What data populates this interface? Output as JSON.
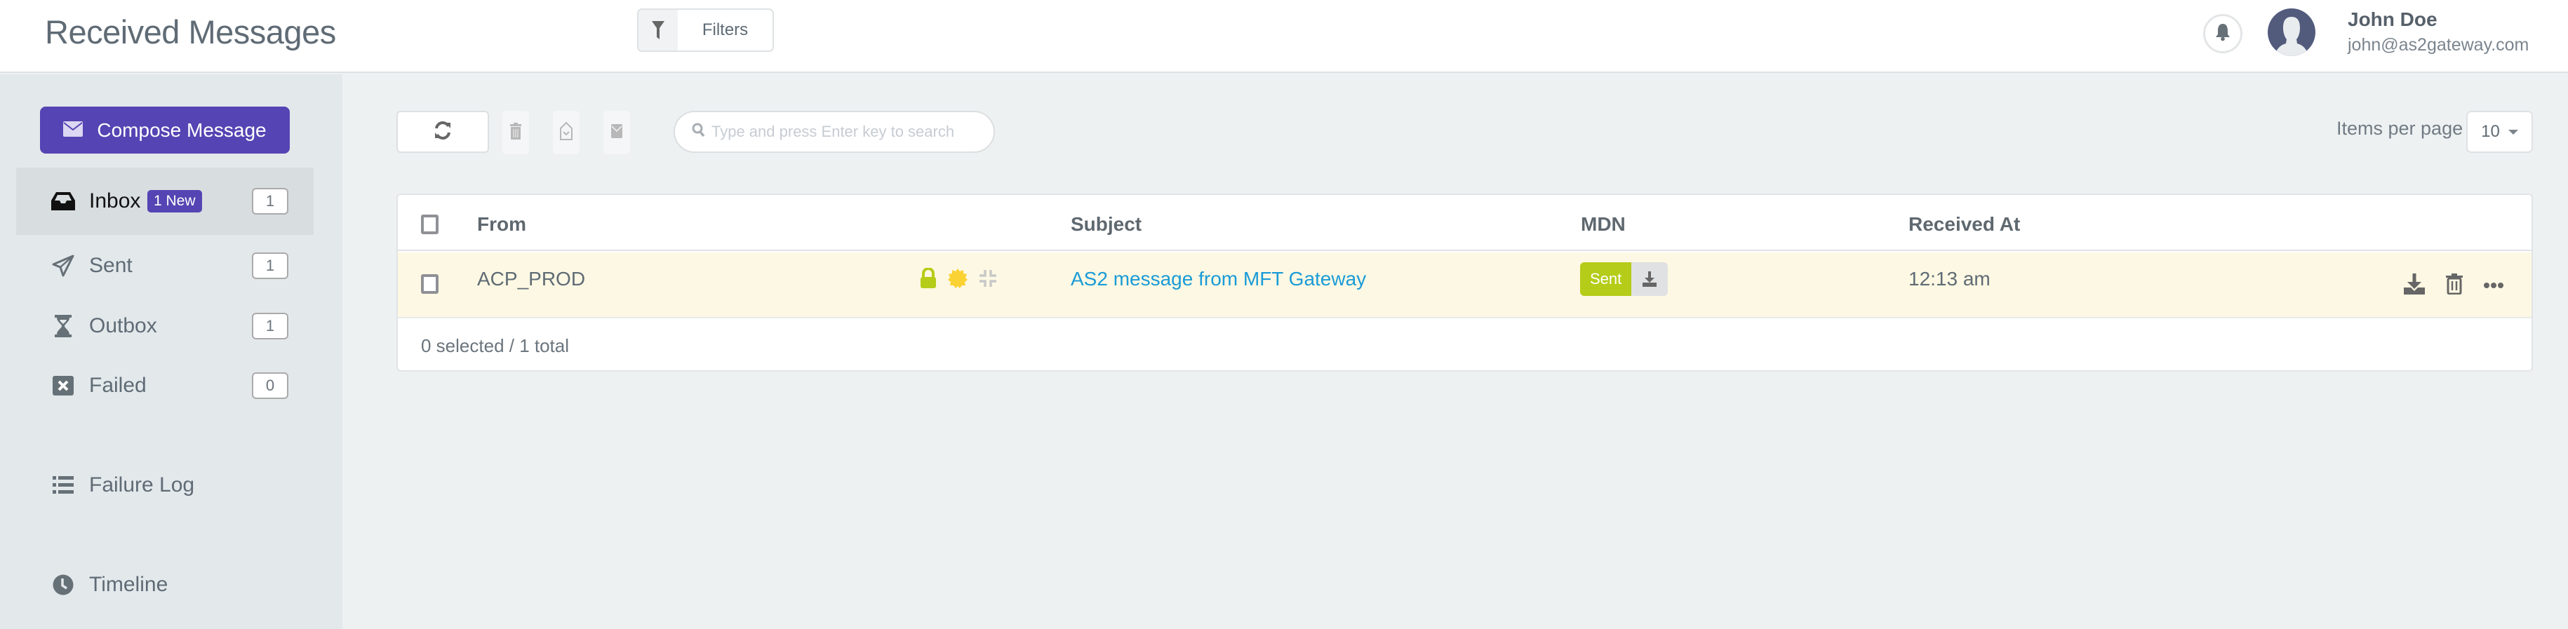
{
  "header": {
    "title": "Received Messages",
    "filters_label": "Filters",
    "user": {
      "name": "John Doe",
      "email": "john@as2gateway.com"
    }
  },
  "sidebar": {
    "compose_label": "Compose Message",
    "items": [
      {
        "label": "Inbox",
        "icon": "inbox-icon",
        "badge": "1 New",
        "count": "1",
        "active": true
      },
      {
        "label": "Sent",
        "icon": "paper-plane-icon",
        "count": "1"
      },
      {
        "label": "Outbox",
        "icon": "hourglass-icon",
        "count": "1"
      },
      {
        "label": "Failed",
        "icon": "x-square-icon",
        "count": "0"
      },
      {
        "label": "Failure Log",
        "icon": "list-icon"
      },
      {
        "label": "Timeline",
        "icon": "clock-icon"
      }
    ]
  },
  "toolbar": {
    "search_placeholder": "Type and press Enter key to search",
    "items_per_page_label": "Items per page",
    "items_per_page_value": "10"
  },
  "table": {
    "columns": [
      "From",
      "Subject",
      "MDN",
      "Received At"
    ],
    "rows": [
      {
        "from": "ACP_PROD",
        "flags": [
          "encrypted-lock-icon",
          "signed-seal-icon",
          "compressed-icon"
        ],
        "subject": "AS2 message from MFT Gateway",
        "mdn_status": "Sent",
        "received_at": "12:13 am"
      }
    ],
    "footer": "0 selected / 1 total"
  },
  "colors": {
    "accent": "#5544b3",
    "mdn_sent": "#b5cc18",
    "link": "#1a9bd7",
    "row_highlight": "#fdf8e3",
    "lock": "#b5cc18",
    "seal": "#fbd233"
  }
}
